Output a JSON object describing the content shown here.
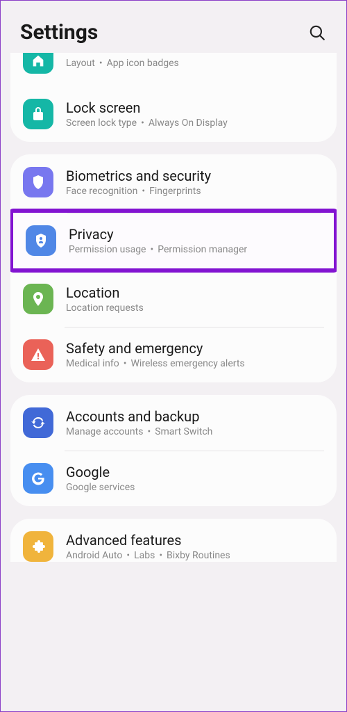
{
  "header": {
    "title": "Settings"
  },
  "group0": {
    "item0": {
      "sub1": "Layout",
      "sub2": "App icon badges",
      "icon_color": "#15b7a6"
    },
    "item1": {
      "title": "Lock screen",
      "sub1": "Screen lock type",
      "sub2": "Always On Display",
      "icon_color": "#15b7a6"
    }
  },
  "group1": {
    "item0": {
      "title": "Biometrics and security",
      "sub1": "Face recognition",
      "sub2": "Fingerprints",
      "icon_color": "#7877ef"
    },
    "item1": {
      "title": "Privacy",
      "sub1": "Permission usage",
      "sub2": "Permission manager",
      "icon_color": "#5087e6"
    },
    "item2": {
      "title": "Location",
      "sub1": "Location requests",
      "icon_color": "#6bb552"
    },
    "item3": {
      "title": "Safety and emergency",
      "sub1": "Medical info",
      "sub2": "Wireless emergency alerts",
      "icon_color": "#ea6258"
    }
  },
  "group2": {
    "item0": {
      "title": "Accounts and backup",
      "sub1": "Manage accounts",
      "sub2": "Smart Switch",
      "icon_color": "#4169d7"
    },
    "item1": {
      "title": "Google",
      "sub1": "Google services",
      "icon_color": "#478ef0"
    }
  },
  "group3": {
    "item0": {
      "title": "Advanced features",
      "sub1": "Android Auto",
      "sub2": "Labs",
      "sub3": "Bixby Routines",
      "icon_color": "#f0b43c"
    }
  }
}
